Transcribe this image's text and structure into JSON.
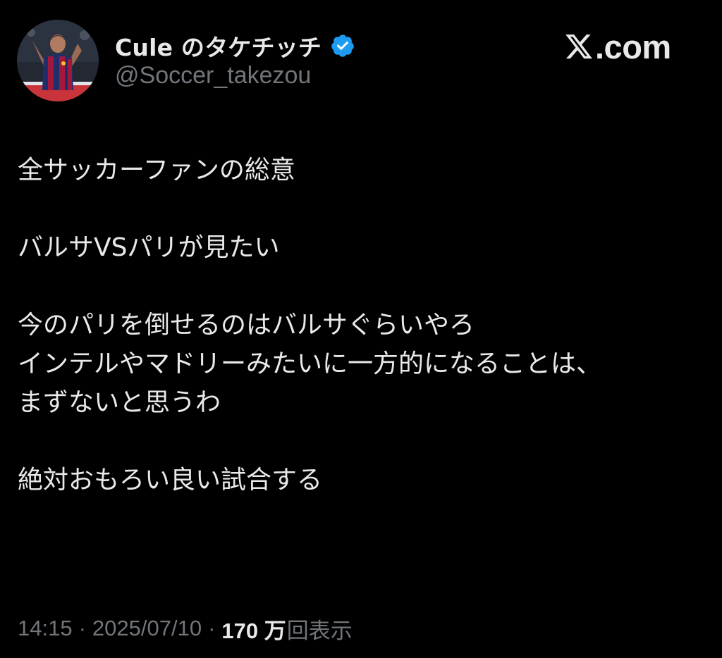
{
  "author": {
    "display_name": "Cule のタケチッチ",
    "handle": "@Soccer_takezou",
    "verified": true,
    "avatar_icon": "player-photo-avatar"
  },
  "brand": {
    "text": ".com",
    "logo_icon": "x-logo-icon"
  },
  "tweet": {
    "text": "全サッカーファンの総意\n\nバルサVSパリが見たい\n\n今のパリを倒せるのはバルサぐらいやろ\nインテルやマドリーみたいに一方的になることは、\nまずないと思うわ\n\n絶対おもろい良い試合する"
  },
  "meta": {
    "time": "14:15",
    "separator": "·",
    "date": "2025/07/10",
    "views_count": "170 万",
    "views_label": "回表示"
  },
  "colors": {
    "background": "#000000",
    "primary_text": "#e7e9ea",
    "secondary_text": "#71767b",
    "verified_badge": "#1d9bf0"
  }
}
